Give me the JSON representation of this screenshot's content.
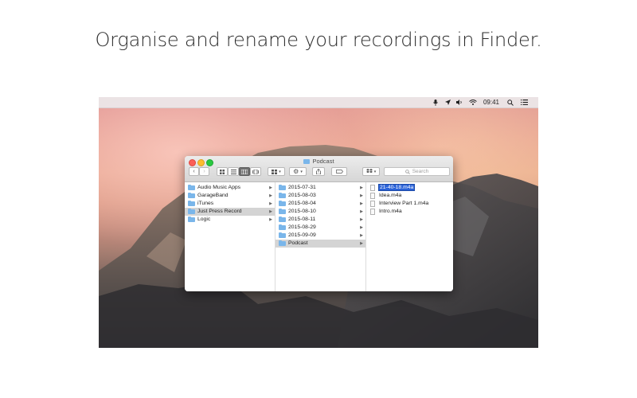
{
  "headline": "Organise and rename your recordings in Finder.",
  "menubar": {
    "clock": "09:41",
    "icons": [
      "microphone-icon",
      "location-arrow-icon",
      "volume-icon",
      "wifi-icon",
      "search-icon",
      "list-icon"
    ]
  },
  "finder": {
    "title": "Podcast",
    "search_placeholder": "Search",
    "column1": [
      {
        "label": "Audio Music Apps",
        "selected": false
      },
      {
        "label": "GarageBand",
        "selected": false
      },
      {
        "label": "iTunes",
        "selected": false
      },
      {
        "label": "Just Press Record",
        "selected": true
      },
      {
        "label": "Logic",
        "selected": false
      }
    ],
    "column2": [
      {
        "label": "2015-07-31",
        "selected": false
      },
      {
        "label": "2015-08-03",
        "selected": false
      },
      {
        "label": "2015-08-04",
        "selected": false
      },
      {
        "label": "2015-08-10",
        "selected": false
      },
      {
        "label": "2015-08-11",
        "selected": false
      },
      {
        "label": "2015-08-29",
        "selected": false
      },
      {
        "label": "2015-09-09",
        "selected": false
      },
      {
        "label": "Podcast",
        "selected": true
      }
    ],
    "column3": [
      {
        "label": "21-40-18.m4a",
        "editing": true
      },
      {
        "label": "Idea.m4a",
        "editing": false
      },
      {
        "label": "Interview Part 1.m4a",
        "editing": false
      },
      {
        "label": "Intro.m4a",
        "editing": false
      }
    ]
  }
}
